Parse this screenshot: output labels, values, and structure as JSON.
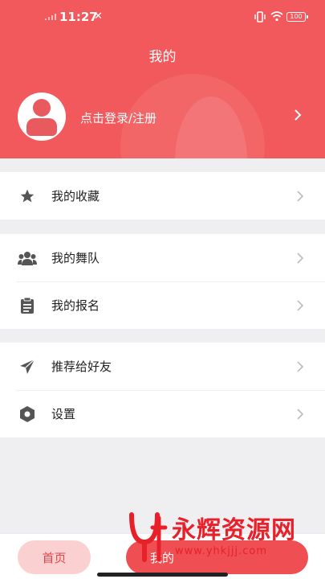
{
  "status_bar": {
    "time": "11:27",
    "battery": "100"
  },
  "header": {
    "title": "我的"
  },
  "profile": {
    "login_text": "点击登录/注册"
  },
  "menu_groups": [
    {
      "items": [
        {
          "icon": "star-icon",
          "label": "我的收藏"
        }
      ]
    },
    {
      "items": [
        {
          "icon": "group-icon",
          "label": "我的舞队"
        },
        {
          "icon": "clipboard-icon",
          "label": "我的报名"
        }
      ]
    },
    {
      "items": [
        {
          "icon": "send-icon",
          "label": "推荐给好友"
        },
        {
          "icon": "settings-hex-icon",
          "label": "设置"
        }
      ]
    }
  ],
  "tab_bar": {
    "home_label": "首页",
    "mine_label": "我的"
  },
  "watermark": {
    "text": "永辉资源网",
    "url": "www.yhkjjj.com"
  },
  "colors": {
    "primary": "#f1595c",
    "home_tab_bg": "#fbd0d1",
    "page_bg": "#efeff2"
  }
}
